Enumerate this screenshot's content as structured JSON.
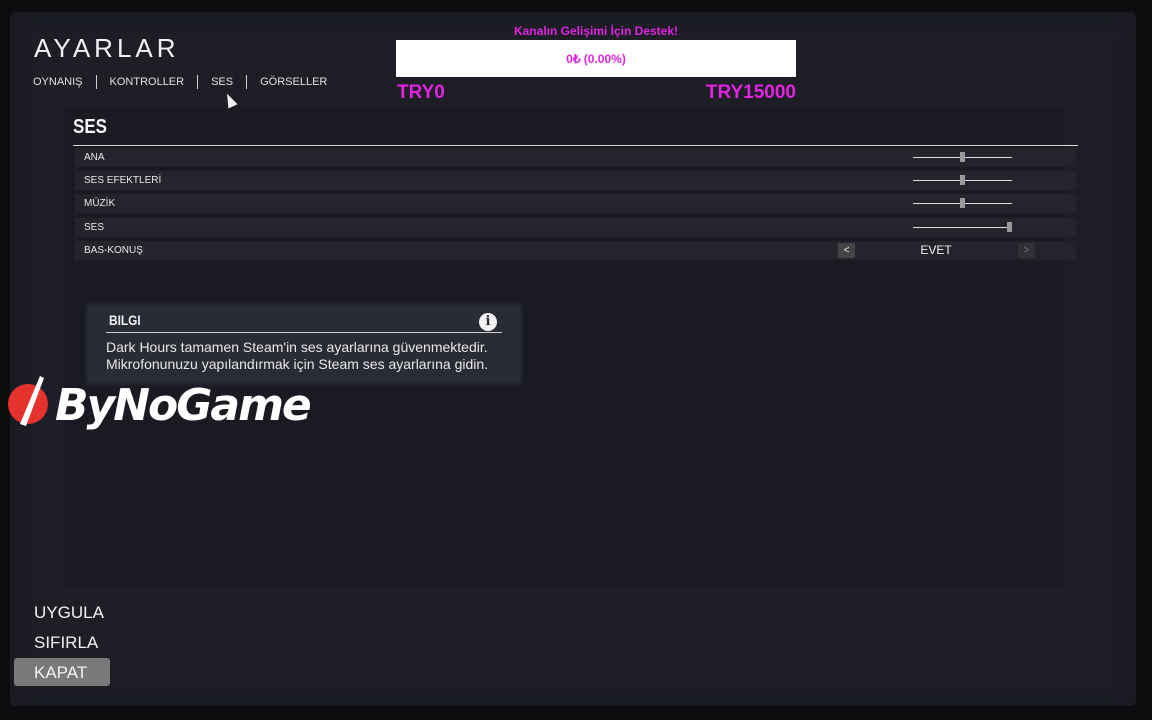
{
  "header": {
    "title": "AYARLAR",
    "tabs": [
      "OYNANIŞ",
      "KONTROLLER",
      "SES",
      "GÖRSELLER"
    ]
  },
  "donation": {
    "title": "Kanalın Gelişimi İçin Destek!",
    "progress_text": "0₺ (0.00%)",
    "progress_fraction": 0.0,
    "min_label": "TRY0",
    "max_label": "TRY15000",
    "color": "#e024e0"
  },
  "section": {
    "title": "SES",
    "rows": [
      {
        "label": "ANA",
        "type": "slider",
        "value": 0.5
      },
      {
        "label": "SES EFEKTLERİ",
        "type": "slider",
        "value": 0.5
      },
      {
        "label": "MÜZİK",
        "type": "slider",
        "value": 0.5
      },
      {
        "label": "SES",
        "type": "slider",
        "value": 1.0
      },
      {
        "label": "BAS-KONUŞ",
        "type": "choice",
        "value": "EVET",
        "prev": "<",
        "next": ">"
      }
    ]
  },
  "info": {
    "title": "BILGI",
    "icon": "info-icon",
    "line1": "Dark Hours tamamen Steam'in ses ayarlarına güvenmektedir.",
    "line2": "Mikrofonunuzu yapılandırmak için Steam ses ayarlarına gidin."
  },
  "watermark": {
    "text": "ByNoGame"
  },
  "actions": {
    "apply": "UYGULA",
    "reset": "SIFIRLA",
    "close": "KAPAT"
  }
}
